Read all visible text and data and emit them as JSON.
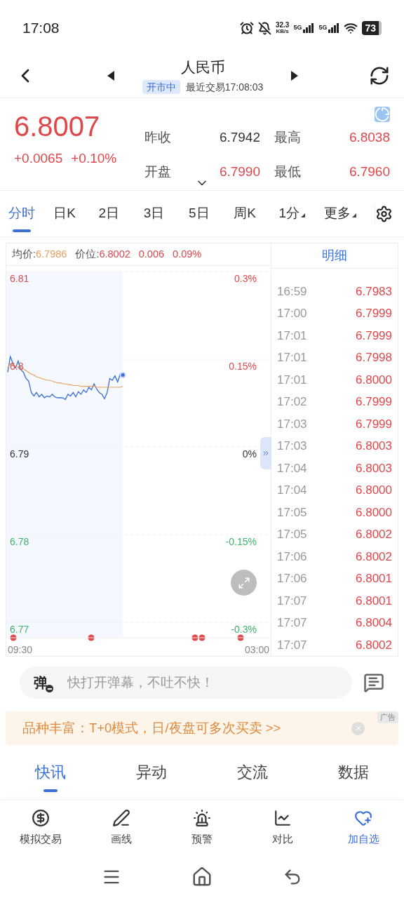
{
  "status_bar": {
    "time": "17:08",
    "speed": "32.3",
    "speed_unit": "KB/s",
    "networks": [
      "5G",
      "5G"
    ],
    "battery": "73"
  },
  "header": {
    "title": "人民币",
    "market_status": "开市中",
    "last_trade": "最近交易17:08:03"
  },
  "quote": {
    "price": "6.8007",
    "change": "+0.0065",
    "change_pct": "+0.10%",
    "stats": [
      {
        "label": "昨收",
        "value": "6.7942",
        "color": "#333333"
      },
      {
        "label": "最高",
        "value": "6.8038",
        "color": "#e0474b"
      },
      {
        "label": "开盘",
        "value": "6.7990",
        "color": "#e0474b"
      },
      {
        "label": "最低",
        "value": "6.7960",
        "color": "#e0474b"
      }
    ]
  },
  "period_tabs": [
    {
      "label": "分时",
      "selected": true,
      "kind": "plain"
    },
    {
      "label": "日K",
      "selected": false,
      "kind": "plain"
    },
    {
      "label": "2日",
      "selected": false,
      "kind": "plain"
    },
    {
      "label": "3日",
      "selected": false,
      "kind": "plain"
    },
    {
      "label": "5日",
      "selected": false,
      "kind": "plain"
    },
    {
      "label": "周K",
      "selected": false,
      "kind": "plain"
    },
    {
      "label": "1分",
      "selected": false,
      "kind": "dropdown"
    },
    {
      "label": "更多",
      "selected": false,
      "kind": "dropdown"
    }
  ],
  "chart_panel": {
    "avg_label": "均价:",
    "avg_value": "6.7986",
    "price_label": "价位:",
    "price_value": "6.8002",
    "change": "0.006",
    "change_pct": "0.09%",
    "time_labels": [
      "09:30",
      "03:00"
    ],
    "percent_labels": [
      {
        "label": "0.3%",
        "kind": "up"
      },
      {
        "label": "0.15%",
        "kind": "up"
      },
      {
        "label": "0%",
        "kind": "flat"
      },
      {
        "label": "-0.15%",
        "kind": "down"
      },
      {
        "label": "-0.3%",
        "kind": "down"
      }
    ],
    "price_labels": [
      {
        "label": "6.81",
        "kind": "up"
      },
      {
        "label": "6.8",
        "kind": "up"
      },
      {
        "label": "6.79",
        "kind": "flat"
      },
      {
        "label": "6.78",
        "kind": "down"
      },
      {
        "label": "6.77",
        "kind": "down"
      }
    ]
  },
  "detail": {
    "title": "明细",
    "rows": [
      {
        "time": "16:59",
        "price": "6.7983"
      },
      {
        "time": "17:00",
        "price": "6.7999"
      },
      {
        "time": "17:01",
        "price": "6.7999"
      },
      {
        "time": "17:01",
        "price": "6.7998"
      },
      {
        "time": "17:01",
        "price": "6.8000"
      },
      {
        "time": "17:02",
        "price": "6.7999"
      },
      {
        "time": "17:03",
        "price": "6.7999"
      },
      {
        "time": "17:03",
        "price": "6.8003"
      },
      {
        "time": "17:04",
        "price": "6.8003"
      },
      {
        "time": "17:04",
        "price": "6.8000"
      },
      {
        "time": "17:05",
        "price": "6.8000"
      },
      {
        "time": "17:05",
        "price": "6.8002"
      },
      {
        "time": "17:06",
        "price": "6.8002"
      },
      {
        "time": "17:06",
        "price": "6.8001"
      },
      {
        "time": "17:07",
        "price": "6.8001"
      },
      {
        "time": "17:07",
        "price": "6.8004"
      },
      {
        "time": "17:07",
        "price": "6.8002"
      }
    ]
  },
  "danmu": {
    "badge": "弹",
    "placeholder": "快打开弹幕，不吐不快！"
  },
  "ad": {
    "text": "品种丰富：T+0模式，日/夜盘可多次买卖 >>",
    "tag": "广告"
  },
  "news_tabs": [
    {
      "label": "快讯",
      "selected": true
    },
    {
      "label": "异动",
      "selected": false
    },
    {
      "label": "交流",
      "selected": false
    },
    {
      "label": "数据",
      "selected": false
    }
  ],
  "toolbar": [
    {
      "label": "模拟交易",
      "kind": "trade",
      "highlighted": false
    },
    {
      "label": "画线",
      "kind": "draw",
      "highlighted": false
    },
    {
      "label": "预警",
      "kind": "alert",
      "highlighted": false
    },
    {
      "label": "对比",
      "kind": "compare",
      "highlighted": false
    },
    {
      "label": "加自选",
      "kind": "favorite",
      "highlighted": true
    }
  ]
}
